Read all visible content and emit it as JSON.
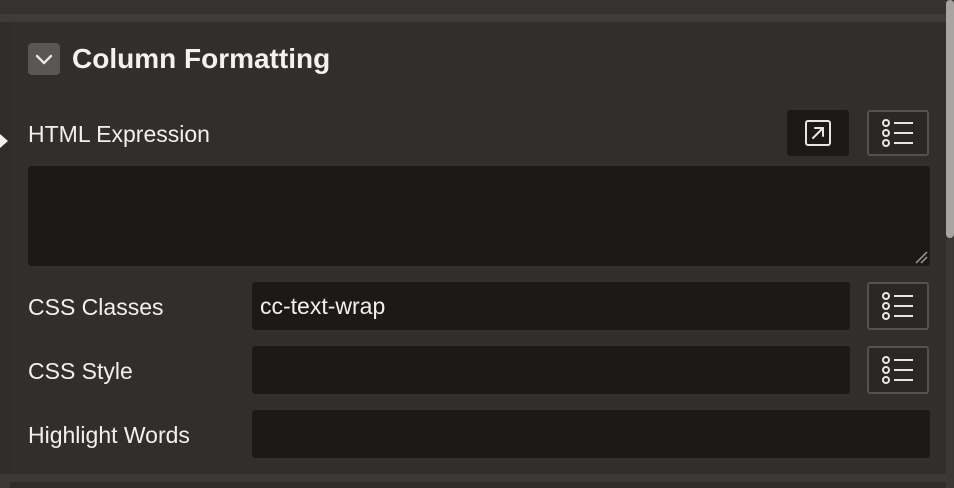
{
  "section": {
    "title": "Column Formatting",
    "toggle_icon": "chevron-down-icon"
  },
  "fields": {
    "html_expression": {
      "label": "HTML Expression",
      "value": "",
      "open_editor_icon": "open-in-editor-icon",
      "list_icon": "list-icon"
    },
    "css_classes": {
      "label": "CSS Classes",
      "value": "cc-text-wrap",
      "list_icon": "list-icon"
    },
    "css_style": {
      "label": "CSS Style",
      "value": "",
      "list_icon": "list-icon"
    },
    "highlight_words": {
      "label": "Highlight Words",
      "value": ""
    }
  },
  "colors": {
    "background": "#2f2d2b",
    "input_background": "#1b1a19",
    "text": "#f2f0ee",
    "toggle_background": "#5a5654"
  }
}
